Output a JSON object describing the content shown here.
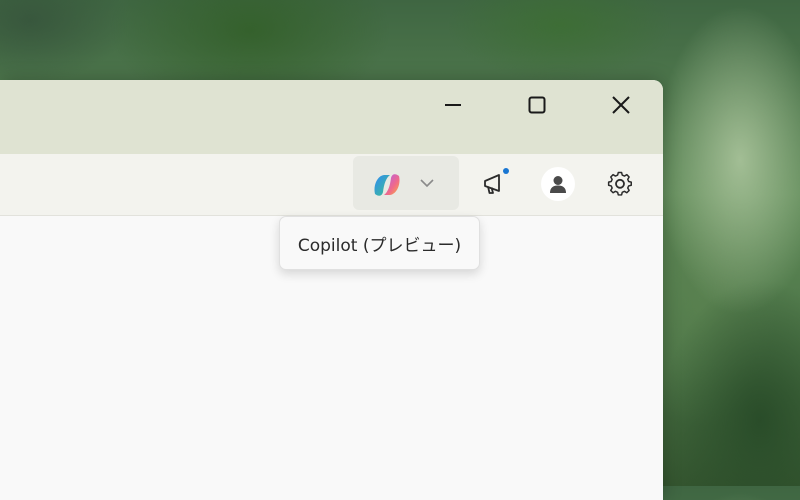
{
  "window": {
    "controls": {
      "minimize_icon": "minimize-icon",
      "maximize_icon": "maximize-icon",
      "close_icon": "close-icon"
    }
  },
  "toolbar": {
    "copilot": {
      "icon": "copilot-logo-icon",
      "dropdown_icon": "chevron-down-icon"
    },
    "announcements": {
      "icon": "megaphone-icon",
      "has_notification": true,
      "notification_color": "#1976d2"
    },
    "account": {
      "icon": "person-icon"
    },
    "settings": {
      "icon": "gear-icon"
    }
  },
  "tooltip": {
    "text": "Copilot (プレビュー)"
  },
  "colors": {
    "titlebar": "#dfe3d2",
    "toolbar": "#f3f3ee",
    "content": "#f9f9f9",
    "copilot_button_bg": "#e8e9e3"
  }
}
